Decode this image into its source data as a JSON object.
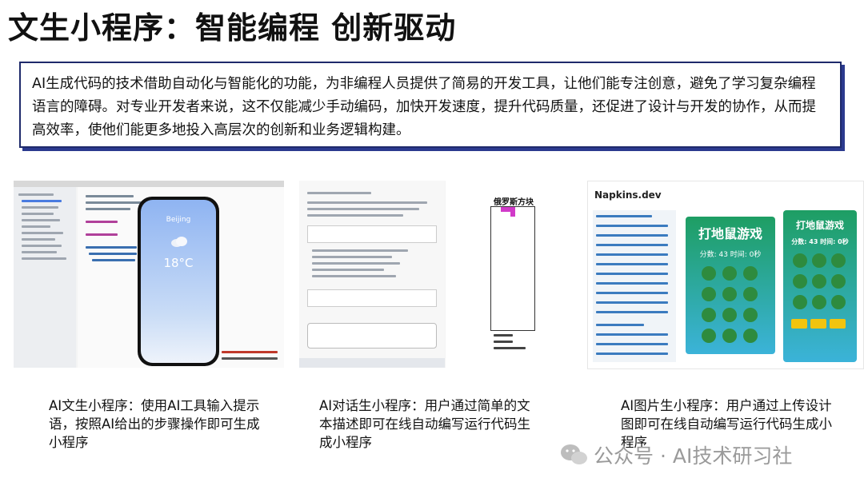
{
  "title": "文生小程序：智能编程 创新驱动",
  "intro": "AI生成代码的技术借助自动化与智能化的功能，为非编程人员提供了简易的开发工具，让他们能专注创意，避免了学习复杂编程语言的障碍。对专业开发者来说，这不仅能减少手动编码，加快开发速度，提升代码质量，还促进了设计与开发的协作，从而提高效率，使他们能更多地投入高层次的创新和业务逻辑构建。",
  "screenshots": {
    "weather": {
      "city": "Beijing",
      "temp": "18°C"
    },
    "chat": {
      "game_title": "俄罗斯方块"
    },
    "image": {
      "brand": "Napkins.dev",
      "game_title": "打地鼠游戏",
      "score_text": "分数: 43 时间: 0秒"
    }
  },
  "captions": [
    "AI文生小程序：使用AI工具输入提示语，按照AI给出的步骤操作即可生成小程序",
    "AI对话生小程序：用户通过简单的文本描述即可在线自动编写运行代码生成小程序",
    "AI图片生小程序：用户通过上传设计图即可在线自动编写运行代码生成小程序"
  ],
  "watermark": "公众号 · AI技术研习社"
}
